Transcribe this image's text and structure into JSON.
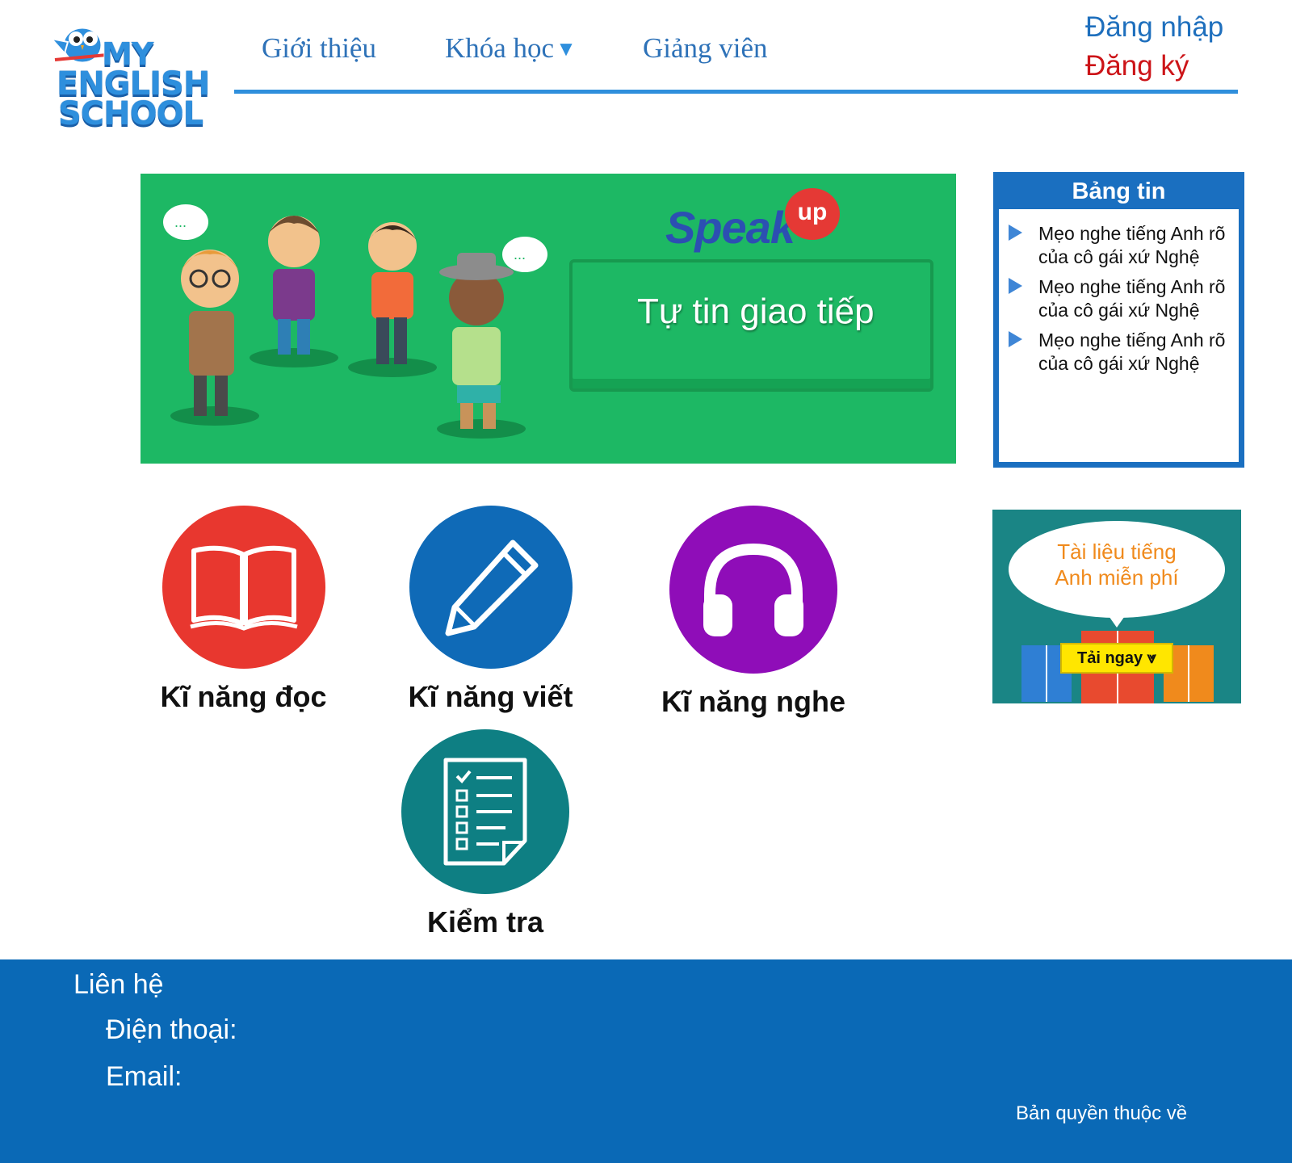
{
  "logo": {
    "line1": "MY",
    "line2": "ENGLISH",
    "line3": "SCHOOL"
  },
  "nav": {
    "intro": "Giới thiệu",
    "courses": "Khóa học",
    "courses_caret": "▼",
    "teachers": "Giảng viên"
  },
  "auth": {
    "login": "Đăng nhập",
    "register": "Đăng ký"
  },
  "banner": {
    "brand": "Speak",
    "brand_badge": "up",
    "cta": "Tự tin giao tiếp"
  },
  "news": {
    "title": "Bảng tin",
    "items": [
      {
        "text": "Mẹo nghe tiếng Anh rõ của cô gái xứ Nghệ"
      },
      {
        "text": "Mẹo nghe tiếng Anh rõ của cô gái xứ Nghệ"
      },
      {
        "text": "Mẹo nghe tiếng Anh rõ của cô gái xứ Nghệ"
      }
    ]
  },
  "ad": {
    "headline_1": "Tài liệu tiếng",
    "headline_2": "Anh miễn phí",
    "button": "Tải ngay ⩔"
  },
  "skills": {
    "reading": {
      "label": "Kĩ năng đọc",
      "color": "#e8372f",
      "icon": "book-icon"
    },
    "writing": {
      "label": "Kĩ năng viết",
      "color": "#0f6ab7",
      "icon": "pencil-icon"
    },
    "listening": {
      "label": "Kĩ năng nghe",
      "color": "#8f0db8",
      "icon": "headphones-icon"
    },
    "test": {
      "label": "Kiểm tra",
      "color": "#0e7f83",
      "icon": "checklist-icon"
    }
  },
  "footer": {
    "contact": "Liên hệ",
    "phone_label": "Điện thoại:",
    "email_label": "Email:",
    "copyright": "Bản quyền thuộc về"
  },
  "colors": {
    "brand_blue": "#0a69b6",
    "nav_blue": "#2e72b8",
    "register_red": "#cc1418",
    "banner_green": "#1db864"
  }
}
